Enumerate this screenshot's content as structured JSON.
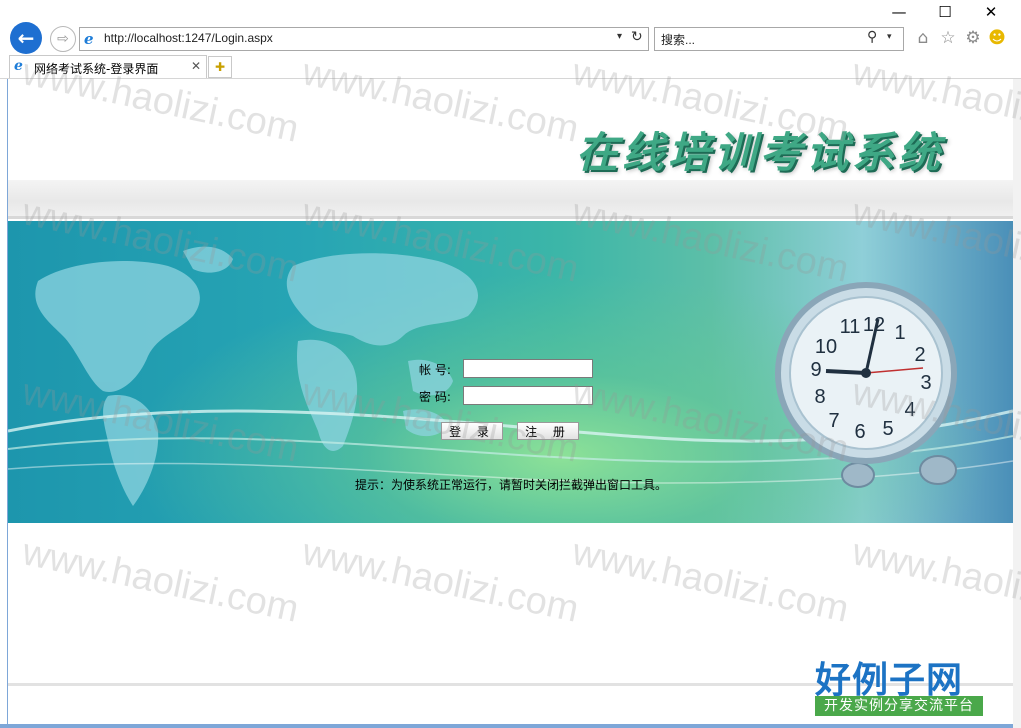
{
  "window": {
    "minimize_glyph": "—",
    "maximize_glyph": "☐",
    "close_glyph": "✕"
  },
  "nav": {
    "address": "http://localhost:1247/Login.aspx",
    "search_placeholder": "搜索..."
  },
  "tab": {
    "title": "网络考试系统-登录界面"
  },
  "page": {
    "site_title": "在线培训考试系统",
    "username_label": "帐 号:",
    "password_label": "密 码:",
    "username_value": "",
    "password_value": "",
    "login_button": "登 录",
    "register_button": "注 册",
    "hint": "提示：为使系统正常运行，请暂时关闭拦截弹出窗口工具。"
  },
  "watermark": {
    "text": "www.haolizi.com"
  },
  "brand": {
    "main": "好例子网",
    "sub": "开发实例分享交流平台"
  },
  "colors": {
    "title_green": "#3fa885",
    "banner_teal": "#1d96ad",
    "browser_blue": "#1e6fd1",
    "brand_blue": "#1c73c4",
    "brand_green": "#4aa84a"
  }
}
